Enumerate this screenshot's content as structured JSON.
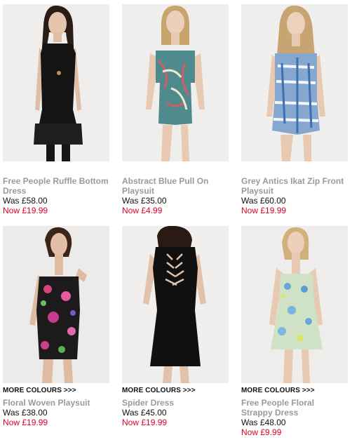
{
  "products": [
    {
      "more": "",
      "name": "Free People Ruffle Bottom Dress",
      "was": "Was £58.00",
      "now": "Now £19.99"
    },
    {
      "more": "",
      "name": "Abstract Blue Pull On Playsuit",
      "was": "Was £35.00",
      "now": "Now £4.99"
    },
    {
      "more": "",
      "name": "Grey Antics Ikat Zip Front Playsuit",
      "was": "Was £60.00",
      "now": "Now £19.99"
    },
    {
      "more": "MORE COLOURS >>>",
      "name": "Floral Woven Playsuit",
      "was": "Was £38.00",
      "now": "Now £19.99"
    },
    {
      "more": "MORE COLOURS >>>",
      "name": "Spider Dress",
      "was": "Was £45.00",
      "now": "Now £19.99"
    },
    {
      "more": "MORE COLOURS >>>",
      "name": "Free People Floral Strappy Dress",
      "was": "Was £48.00",
      "now": "Now £9.99"
    }
  ],
  "colors": {
    "sale": "#e0002a",
    "name": "#9a9a9a",
    "photo_bg": "#ecebea"
  }
}
